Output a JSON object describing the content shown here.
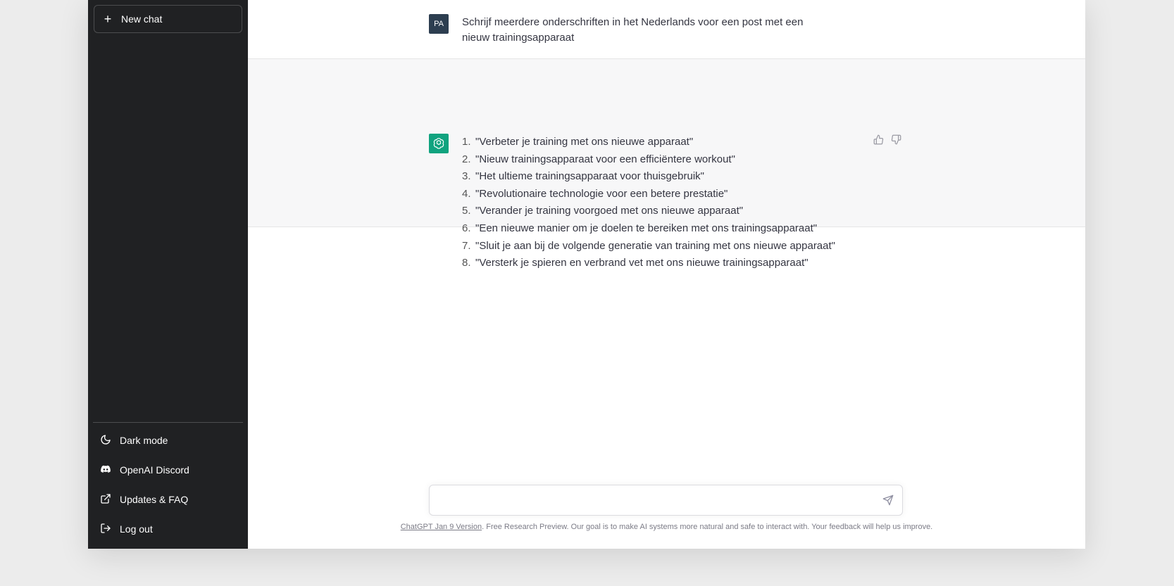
{
  "sidebar": {
    "new_chat_label": "New chat",
    "items": [
      {
        "label": "Dark mode",
        "icon": "moon-icon"
      },
      {
        "label": "OpenAI Discord",
        "icon": "discord-icon"
      },
      {
        "label": "Updates & FAQ",
        "icon": "external-link-icon"
      },
      {
        "label": "Log out",
        "icon": "logout-icon"
      }
    ]
  },
  "conversation": {
    "user_initials": "PA",
    "user_message": "Schrijf meerdere onderschriften in het Nederlands voor een post met een nieuw trainingsapparaat",
    "assistant_items": [
      {
        "num": "1.",
        "text": "\"Verbeter je training met ons nieuwe apparaat\""
      },
      {
        "num": "2.",
        "text": "\"Nieuw trainingsapparaat voor een efficiëntere workout\""
      },
      {
        "num": "3.",
        "text": "\"Het ultieme trainingsapparaat voor thuisgebruik\""
      },
      {
        "num": "4.",
        "text": "\"Revolutionaire technologie voor een betere prestatie\""
      },
      {
        "num": "5.",
        "text": "\"Verander je training voorgoed met ons nieuwe apparaat\""
      },
      {
        "num": "6.",
        "text": "\"Een nieuwe manier om je doelen te bereiken met ons trainingsapparaat\""
      },
      {
        "num": "7.",
        "text": "\"Sluit je aan bij de volgende generatie van training met ons nieuwe apparaat\""
      },
      {
        "num": "8.",
        "text": "\"Versterk je spieren en verbrand vet met ons nieuwe trainingsapparaat\""
      }
    ]
  },
  "composer": {
    "value": ""
  },
  "footer": {
    "version_link": "ChatGPT Jan 9 Version",
    "note": ". Free Research Preview. Our goal is to make AI systems more natural and safe to interact with. Your feedback will help us improve."
  },
  "colors": {
    "sidebar_bg": "#202123",
    "assistant_avatar": "#10a37f",
    "user_avatar": "#2d3e50",
    "assistant_row_bg": "#f7f7f8"
  }
}
